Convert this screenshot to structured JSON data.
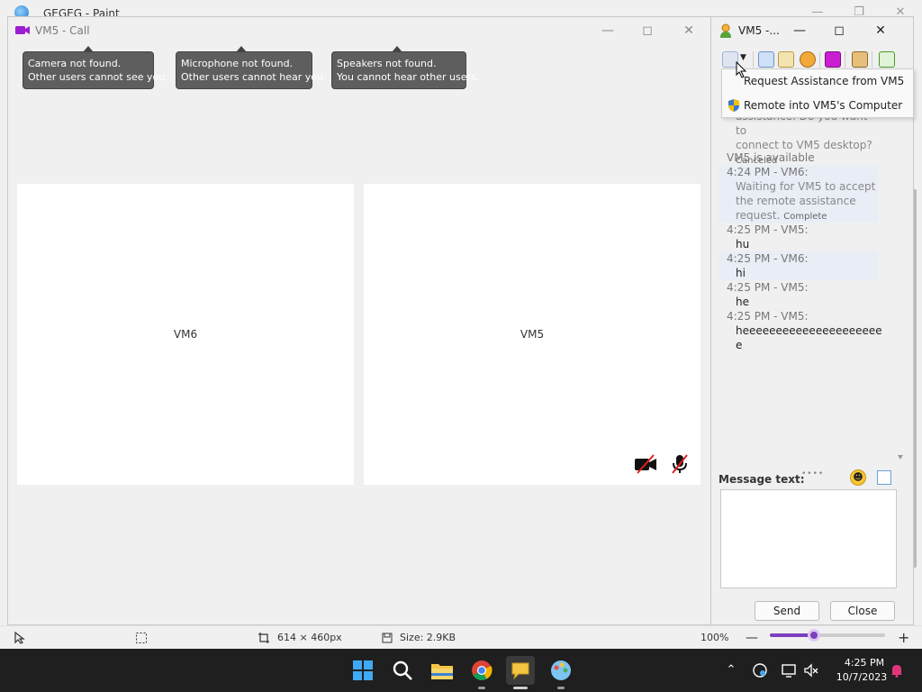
{
  "paint": {
    "title": "GEGEG - Paint",
    "status": {
      "dimensions": "614 × 460px",
      "size": "Size: 2.9KB",
      "zoom": "100%",
      "zoom_level": 0.38
    }
  },
  "call_window": {
    "title": "VM5 - Call",
    "tooltips": [
      {
        "line1": "Camera not found.",
        "line2": "Other users cannot see you."
      },
      {
        "line1": "Microphone not found.",
        "line2": "Other users cannot hear you."
      },
      {
        "line1": "Speakers not found.",
        "line2": "You cannot hear other users."
      }
    ],
    "panels": [
      {
        "label": "VM6"
      },
      {
        "label": "VM5"
      }
    ]
  },
  "chat_window": {
    "title": "VM5 -...",
    "menu": {
      "items": [
        {
          "label": "Request Assistance from VM5"
        },
        {
          "label": "Remote into VM5's Computer"
        }
      ]
    },
    "messages": {
      "m0": {
        "body1": "assistance. Do you want to",
        "body2": "connect to VM5 desktop?",
        "note": "Canceled"
      },
      "m1": {
        "text": "VM5 is available"
      },
      "m2": {
        "header": "4:24 PM - VM6:",
        "body1": "Waiting for VM5 to accept",
        "body2": "the remote assistance",
        "body3": "request.",
        "note": "Complete"
      },
      "m3": {
        "header": "4:25 PM - VM5:",
        "body": "hu"
      },
      "m4": {
        "header": "4:25 PM - VM6:",
        "body": "hi"
      },
      "m5": {
        "header": "4:25 PM - VM5:",
        "body": "he"
      },
      "m6": {
        "header": "4:25 PM - VM5:",
        "body1": "heeeeeeeeeeeeeeeeeeeee",
        "body2": "e"
      }
    },
    "message_label": "Message text:",
    "message_input_value": "",
    "send_label": "Send",
    "close_label": "Close"
  },
  "taskbar": {
    "time": "4:25 PM",
    "date": "10/7/2023"
  },
  "colors": {
    "accent": "#7b3fbf",
    "call_icon": "#9b1fd1",
    "shaded_message": "#e8edf6",
    "taskbar": "#1f1f1f"
  }
}
